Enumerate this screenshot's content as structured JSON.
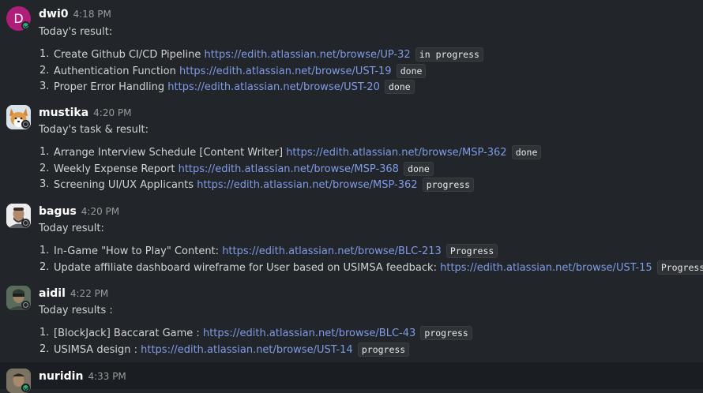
{
  "messages": [
    {
      "author": "dwi0",
      "time": "4:18 PM",
      "avatar_initial": "D",
      "avatar_color": "#b01e7b",
      "presence": "active",
      "intro": "Today's result:",
      "items": [
        {
          "num": "1.",
          "text": "Create Github CI/CD Pipeline",
          "link": "https://edith.atlassian.net/browse/UP-32",
          "status": "in progress"
        },
        {
          "num": "2.",
          "text": "Authentication Function",
          "link": "https://edith.atlassian.net/browse/UST-19",
          "status": "done"
        },
        {
          "num": "3.",
          "text": "Proper Error Handling",
          "link": "https://edith.atlassian.net/browse/UST-20",
          "status": "done"
        }
      ]
    },
    {
      "author": "mustika",
      "time": "4:20 PM",
      "presence": "away",
      "intro": "Today's task & result:",
      "items": [
        {
          "num": "1.",
          "text": "Arrange Interview Schedule [Content Writer]",
          "link": "https://edith.atlassian.net/browse/MSP-362",
          "status": "done"
        },
        {
          "num": "2.",
          "text": "Weekly Expense Report",
          "link": "https://edith.atlassian.net/browse/MSP-368",
          "status": "done"
        },
        {
          "num": "3.",
          "text": "Screening UI/UX Applicants",
          "link": "https://edith.atlassian.net/browse/MSP-362",
          "status": "progress"
        }
      ]
    },
    {
      "author": "bagus",
      "time": "4:20 PM",
      "presence": "away",
      "intro": "Today result:",
      "items": [
        {
          "num": "1.",
          "text": "In-Game \"How to Play\" Content:",
          "link": "https://edith.atlassian.net/browse/BLC-213",
          "status": "Progress"
        },
        {
          "num": "2.",
          "text": "Update affiliate dashboard wireframe for User based on USIMSA feedback:",
          "link": "https://edith.atlassian.net/browse/UST-15",
          "status": "Progress"
        }
      ]
    },
    {
      "author": "aidil",
      "time": "4:22 PM",
      "presence": "away",
      "intro": "Today results :",
      "items": [
        {
          "num": "1.",
          "text": "[BlockJack] Baccarat Game :",
          "link": "https://edith.atlassian.net/browse/BLC-43",
          "status": "progress"
        },
        {
          "num": "2.",
          "text": "USIMSA design :",
          "link": "https://edith.atlassian.net/browse/UST-14",
          "status": "progress"
        }
      ]
    },
    {
      "author": "nuridin",
      "time": "4:33 PM",
      "presence": "active"
    }
  ]
}
